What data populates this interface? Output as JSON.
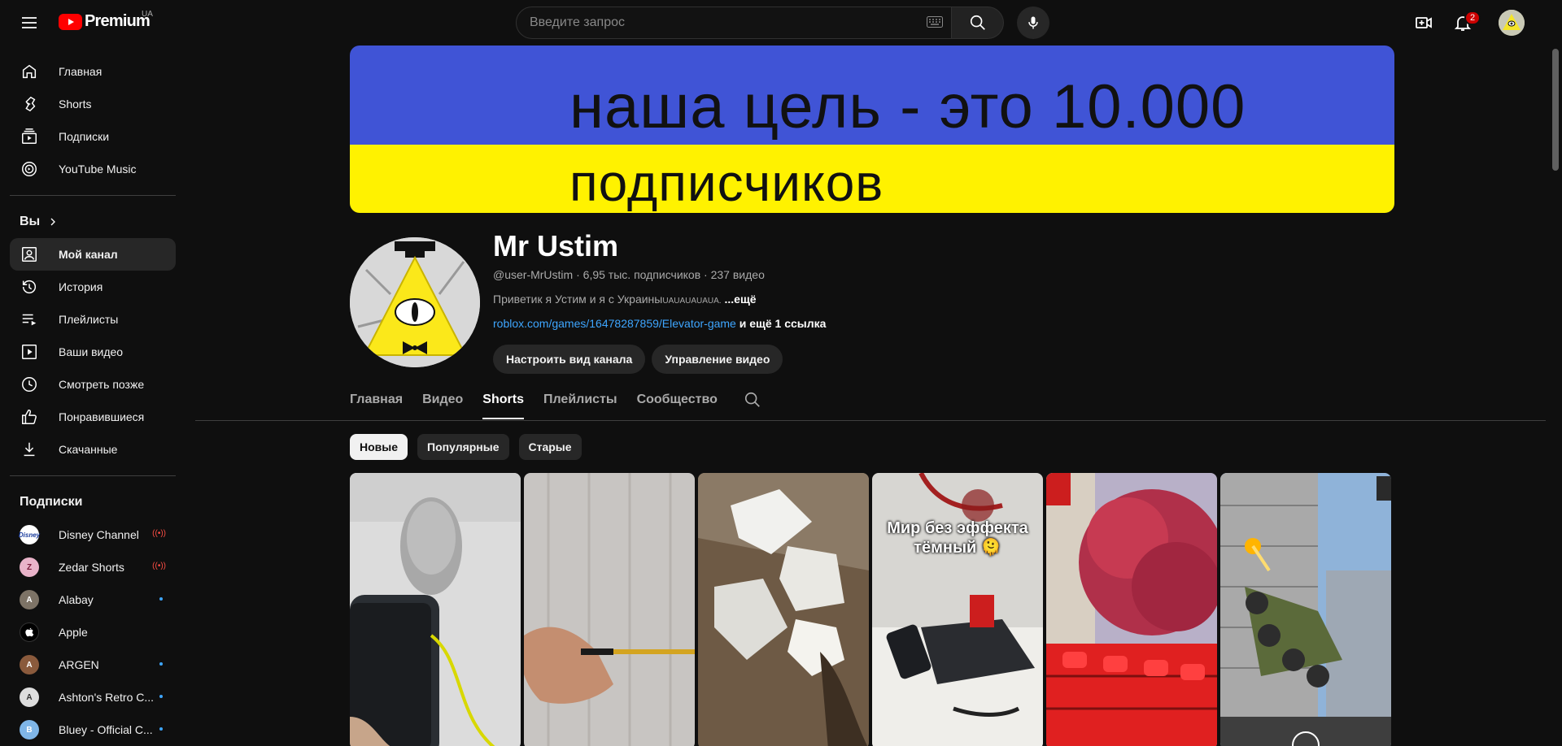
{
  "topbar": {
    "logo_text": "Premium",
    "logo_country": "UA",
    "search_placeholder": "Введите запрос",
    "notifications_count": "2"
  },
  "sidebar": {
    "main_items": [
      {
        "label": "Главная",
        "icon": "home-icon"
      },
      {
        "label": "Shorts",
        "icon": "shorts-icon"
      },
      {
        "label": "Подписки",
        "icon": "subscriptions-icon"
      },
      {
        "label": "YouTube Music",
        "icon": "music-icon"
      }
    ],
    "you_header": "Вы",
    "you_items": [
      {
        "label": "Мой канал",
        "icon": "my-channel-icon",
        "active": true
      },
      {
        "label": "История",
        "icon": "history-icon"
      },
      {
        "label": "Плейлисты",
        "icon": "playlists-icon"
      },
      {
        "label": "Ваши видео",
        "icon": "your-videos-icon"
      },
      {
        "label": "Смотреть позже",
        "icon": "watch-later-icon"
      },
      {
        "label": "Понравившиеся",
        "icon": "liked-icon"
      },
      {
        "label": "Скачанные",
        "icon": "downloads-icon"
      }
    ],
    "subs_header": "Подписки",
    "subscriptions": [
      {
        "label": "Disney Channel",
        "status": "live"
      },
      {
        "label": "Zedar Shorts",
        "status": "live"
      },
      {
        "label": "Alabay",
        "status": "new"
      },
      {
        "label": "Apple",
        "status": "none"
      },
      {
        "label": "ARGEN",
        "status": "new"
      },
      {
        "label": "Ashton's Retro C...",
        "status": "new"
      },
      {
        "label": "Bluey - Official C...",
        "status": "new"
      }
    ]
  },
  "banner": {
    "line1": "наша цель - это 10.000",
    "line2": "подписчиков",
    "colors": {
      "top": "#4054d6",
      "bottom": "#fff200"
    }
  },
  "channel": {
    "name": "Mr Ustim",
    "handle": "@user-MrUstim",
    "subscribers": "6,95 тыс. подписчиков",
    "videos": "237 видео",
    "description": "Приветик я Устим и я с Украины",
    "description_tail": "UAUAUAUAUA.",
    "more": "...ещё",
    "link": "roblox.com/games/16478287859/Elevator-game",
    "link_more": "и ещё 1 ссылка",
    "customize_button": "Настроить вид канала",
    "manage_button": "Управление видео"
  },
  "tabs": [
    "Главная",
    "Видео",
    "Shorts",
    "Плейлисты",
    "Сообщество"
  ],
  "active_tab": "Shorts",
  "chips": [
    "Новые",
    "Популярные",
    "Старые"
  ],
  "active_chip": "Новые",
  "shorts": [
    {
      "caption": ""
    },
    {
      "caption": ""
    },
    {
      "caption": ""
    },
    {
      "caption": "Мир без эффекта тёмный 🫠"
    },
    {
      "caption": ""
    },
    {
      "caption": ""
    }
  ]
}
